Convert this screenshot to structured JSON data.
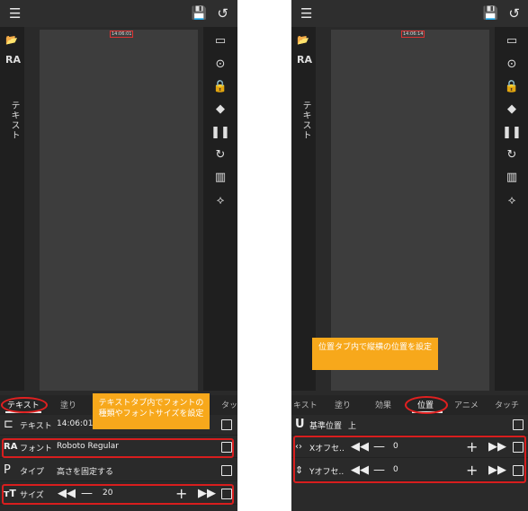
{
  "left_panel": {
    "timestamp": "14:06:01",
    "side_label": "テキスト",
    "tabs": [
      "テキスト",
      "塗り",
      "",
      "タッ"
    ],
    "callout": "テキストタブ内でフォントの種類やフォントサイズを設定",
    "rows": [
      {
        "icon": "text-icon",
        "label": "テキスト",
        "value": "14:06:01"
      },
      {
        "icon": "font-icon",
        "label": "フォント",
        "value": "Roboto Regular"
      },
      {
        "icon": "type-icon",
        "label": "タイプ",
        "value": "高さを固定する"
      },
      {
        "icon": "size-icon",
        "label": "サイズ",
        "value": "20"
      }
    ]
  },
  "right_panel": {
    "timestamp": "14:06:14",
    "side_label": "テキスト",
    "tabs": [
      "キスト",
      "塗り",
      "効果",
      "位置",
      "アニメ",
      "タッチ"
    ],
    "callout": "位置タブ内で縦横の位置を設定",
    "rows": [
      {
        "icon": "anchor-icon",
        "label": "基準位置",
        "value": "上"
      },
      {
        "icon": "x-offset-icon",
        "label": "Xオフセ..",
        "value": "0"
      },
      {
        "icon": "y-offset-icon",
        "label": "Yオフセ..",
        "value": "0"
      }
    ]
  },
  "colors": {
    "highlight": "#d81e1e",
    "callout": "#f7a81b",
    "background": "#2a2a2a"
  }
}
